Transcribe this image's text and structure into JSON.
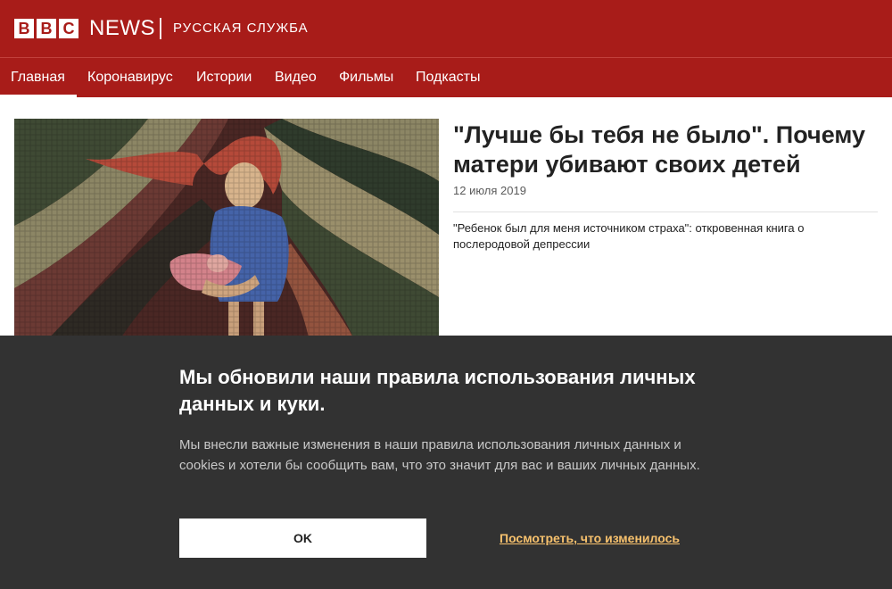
{
  "brand": {
    "bbc_letters": [
      "B",
      "B",
      "C"
    ],
    "news": "NEWS",
    "service": "РУССКАЯ СЛУЖБА",
    "color": "#a81c19"
  },
  "nav": {
    "items": [
      {
        "label": "Главная",
        "active": true
      },
      {
        "label": "Коронавирус"
      },
      {
        "label": "Истории"
      },
      {
        "label": "Видео"
      },
      {
        "label": "Фильмы"
      },
      {
        "label": "Подкасты"
      }
    ]
  },
  "article": {
    "headline": "\"Лучше бы тебя не было\". Почему матери убивают своих детей",
    "date": "12 июля 2019",
    "related": "\"Ребенок был для меня источником страха\": откровенная книга о послеродовой депрессии",
    "image_subject": "mosaic-illustration-mother-with-baby"
  },
  "cookie_banner": {
    "title": "Мы обновили наши правила использования личных данных и куки.",
    "body": "Мы внесли важные изменения в наши правила использования личных данных и cookies и хотели бы сообщить вам, что это значит для вас и ваших личных данных.",
    "ok_label": "OK",
    "link_label": "Посмотреть, что изменилось",
    "link_color": "#f7c16d"
  }
}
